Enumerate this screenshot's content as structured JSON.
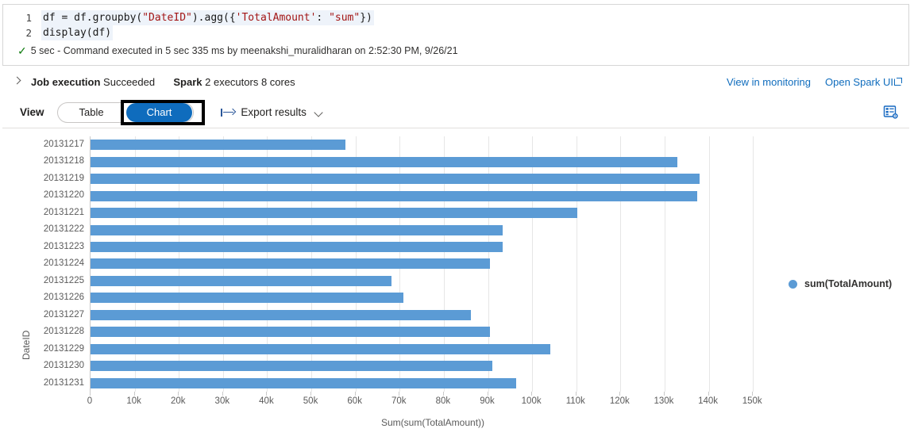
{
  "notebook": {
    "code": {
      "lines": [
        {
          "num": "1",
          "segments": [
            {
              "t": "df = df.groupby(",
              "k": "plain"
            },
            {
              "t": "\"DateID\"",
              "k": "str"
            },
            {
              "t": ").agg({",
              "k": "plain"
            },
            {
              "t": "'TotalAmount'",
              "k": "str"
            },
            {
              "t": ": ",
              "k": "plain"
            },
            {
              "t": "\"sum\"",
              "k": "str"
            },
            {
              "t": "})",
              "k": "plain"
            }
          ]
        },
        {
          "num": "2",
          "segments": [
            {
              "t": "display(df)",
              "k": "plain"
            }
          ]
        }
      ]
    },
    "status": {
      "icon": "check-icon",
      "text": "5 sec - Command executed in 5 sec 335 ms by meenakshi_muralidharan on 2:52:30 PM, 9/26/21"
    }
  },
  "job_bar": {
    "expand_icon": "chevron-right-icon",
    "title": "Job execution",
    "state": "Succeeded",
    "engine": "Spark",
    "engine_detail": "2 executors 8 cores",
    "links": [
      {
        "label": "View in monitoring",
        "external": false
      },
      {
        "label": "Open Spark UI",
        "external": true
      }
    ]
  },
  "toolbar": {
    "view_label": "View",
    "toggle": {
      "options": [
        "Table",
        "Chart"
      ],
      "selected": "Chart"
    },
    "export_label": "Export results",
    "settings_icon": "chart-settings-icon"
  },
  "colors": {
    "accent": "#0f6cbd",
    "bar": "#5b9bd5",
    "success": "#107c10",
    "grid": "#e6e6e6",
    "axis": "#c9c9c9",
    "annotation": "#000000"
  },
  "chart_data": {
    "type": "bar",
    "orientation": "horizontal",
    "title": "",
    "xlabel": "Sum(sum(TotalAmount))",
    "ylabel": "DateID",
    "xlim": [
      0,
      155000
    ],
    "xticks": [
      0,
      10000,
      20000,
      30000,
      40000,
      50000,
      60000,
      70000,
      80000,
      90000,
      100000,
      110000,
      120000,
      130000,
      140000,
      150000
    ],
    "xticklabels": [
      "0",
      "10k",
      "20k",
      "30k",
      "40k",
      "50k",
      "60k",
      "70k",
      "80k",
      "90k",
      "100k",
      "110k",
      "120k",
      "130k",
      "140k",
      "150k"
    ],
    "grid": true,
    "legend": [
      "sum(TotalAmount)"
    ],
    "legend_position": "right",
    "categories": [
      "20131217",
      "20131218",
      "20131219",
      "20131220",
      "20131221",
      "20131222",
      "20131223",
      "20131224",
      "20131225",
      "20131226",
      "20131227",
      "20131228",
      "20131229",
      "20131230",
      "20131231"
    ],
    "series": [
      {
        "name": "sum(TotalAmount)",
        "color": "#5b9bd5",
        "values": [
          57800,
          132800,
          137900,
          137400,
          110300,
          93400,
          93400,
          90400,
          68200,
          70800,
          86100,
          90400,
          104200,
          91000,
          96400
        ]
      }
    ]
  }
}
